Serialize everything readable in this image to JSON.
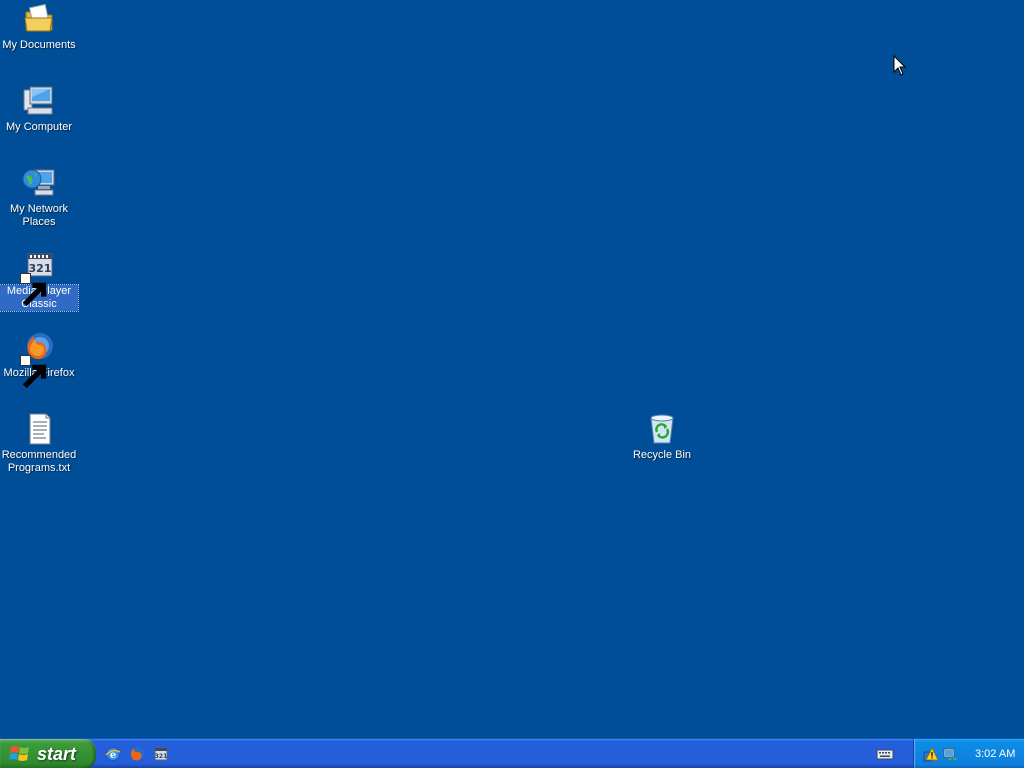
{
  "desktop": {
    "background": "#004e98",
    "icons": [
      {
        "label": "My Documents",
        "icon": "my-documents-icon"
      },
      {
        "label": "My Computer",
        "icon": "my-computer-icon"
      },
      {
        "label": "My Network Places",
        "icon": "network-places-icon"
      },
      {
        "label": "Media Player Classic",
        "icon": "media-player-classic-icon",
        "selected": true,
        "shortcut": true
      },
      {
        "label": "Mozilla Firefox",
        "icon": "firefox-icon",
        "shortcut": true
      },
      {
        "label": "Recommended Programs.txt",
        "icon": "text-file-icon"
      },
      {
        "label": "Recycle Bin",
        "icon": "recycle-bin-icon"
      }
    ]
  },
  "taskbar": {
    "start_label": "start",
    "quick_launch": [
      {
        "name": "internet-explorer-icon"
      },
      {
        "name": "firefox-icon"
      },
      {
        "name": "media-player-classic-icon"
      }
    ],
    "language_icon": "keyboard-icon",
    "tray": {
      "icons": [
        "security-warning-icon",
        "network-connection-icon"
      ],
      "clock": "3:02 AM"
    }
  },
  "colors": {
    "taskbar_blue": "#245edb",
    "start_green": "#3c9a3c",
    "tray_blue": "#0f7fdc",
    "selection": "#316ac5"
  }
}
